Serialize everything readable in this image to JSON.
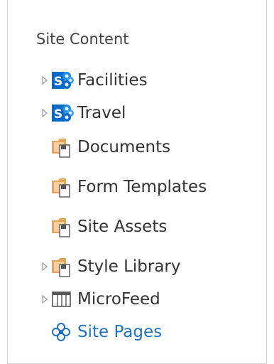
{
  "panel": {
    "heading": "Site Content"
  },
  "items": [
    {
      "label": "Facilities",
      "expandable": true,
      "icon": "sharepoint-site-icon"
    },
    {
      "label": "Travel",
      "expandable": true,
      "icon": "sharepoint-site-icon"
    },
    {
      "label": "Documents",
      "expandable": false,
      "icon": "document-library-icon"
    },
    {
      "label": "Form Templates",
      "expandable": false,
      "icon": "document-library-icon"
    },
    {
      "label": "Site Assets",
      "expandable": false,
      "icon": "document-library-icon"
    },
    {
      "label": "Style Library",
      "expandable": true,
      "icon": "document-library-icon"
    },
    {
      "label": "MicroFeed",
      "expandable": true,
      "icon": "list-icon"
    },
    {
      "label": "Site Pages",
      "expandable": false,
      "icon": "site-pages-icon"
    }
  ],
  "colors": {
    "sharepoint_blue": "#0b6ac9",
    "library_orange": "#e8a35a",
    "link_blue": "#1f72c4",
    "text": "#333333"
  }
}
